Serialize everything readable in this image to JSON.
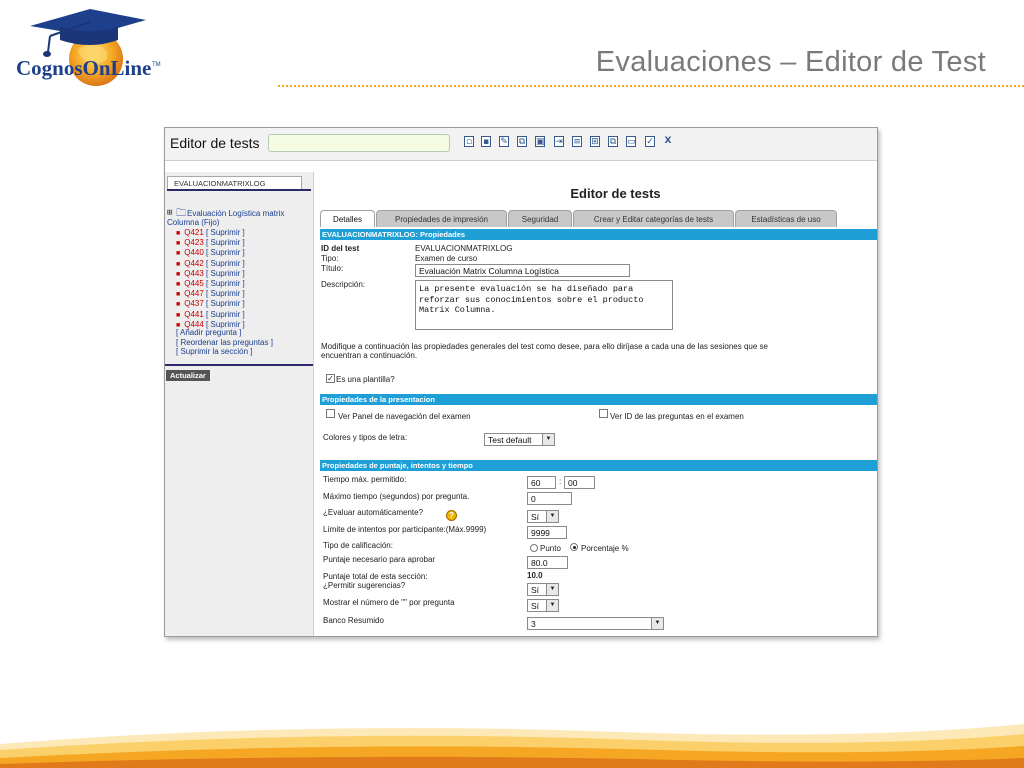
{
  "brand": {
    "logo_text": "CognosOnLine",
    "trademark": "TM"
  },
  "slide": {
    "title": "Evaluaciones – Editor de Test"
  },
  "toolbar": {
    "label": "Editor de tests",
    "input_value": "",
    "icons": [
      "new-doc-icon",
      "save-icon",
      "edit-icon",
      "copy-icon",
      "delete-icon",
      "export-icon",
      "document-icon",
      "tree-icon",
      "duplicate-icon",
      "folder-icon",
      "check-icon",
      "close-x-icon"
    ]
  },
  "sidebar": {
    "tab_label": "EVALUACIONMATRIXLOG",
    "tree_toggle": "⊞",
    "root_label": "Evaluación Logística matrix Columna (Fijo)",
    "items": [
      {
        "id": "Q421",
        "action": "Suprimir"
      },
      {
        "id": "Q423",
        "action": "Suprimir"
      },
      {
        "id": "Q440",
        "action": "Suprimir"
      },
      {
        "id": "Q442",
        "action": "Suprimir"
      },
      {
        "id": "Q443",
        "action": "Suprimir"
      },
      {
        "id": "Q445",
        "action": "Suprimir"
      },
      {
        "id": "Q447",
        "action": "Suprimir"
      },
      {
        "id": "Q437",
        "action": "Suprimir"
      },
      {
        "id": "Q441",
        "action": "Suprimir"
      },
      {
        "id": "Q444",
        "action": "Suprimir"
      }
    ],
    "actions": [
      "[ Añadir pregunta ]",
      "[ Reordenar las preguntas ]",
      "[ Suprimir la sección ]"
    ],
    "update_button": "Actualizar"
  },
  "main": {
    "title": "Editor de tests",
    "tabs": [
      "Detalles",
      "Propiedades de impresión",
      "Seguridad",
      "Crear y Editar categorías de tests",
      "Estadísticas de uso"
    ],
    "active_tab": "Detalles",
    "properties_header": "EVALUACIONMATRIXLOG: Propiedades",
    "fields": {
      "id_label": "ID del test",
      "id_value": "EVALUACIONMATRIXLOG",
      "type_label": "Tipo:",
      "type_value": "Examen de curso",
      "title_label": "Título:",
      "title_value": "Evaluación Matrix Columna Logística",
      "desc_label": "Descripción:",
      "desc_value": "La presente evaluación se ha diseñado para\nreforzar sus conocimientos sobre el producto\nMatrix Columna."
    },
    "info_text_1": "Modifique a continuación las propiedades generales del test como desee, para ello diríjase a cada una de las sesiones que se",
    "info_text_2": "encuentran a continuación.",
    "template_label": "Es una plantilla?",
    "template_checked": true,
    "presentation_header": "Propiedades de la presentacion",
    "nav_panel_label": "Ver Panel de navegación del examen",
    "show_ids_label": "Ver ID de las preguntas en el examen",
    "colors_label": "Colores y tipos de letra:",
    "colors_value": "Test default",
    "scoring_header": "Propiedades de puntaje, intentos y tiempo",
    "scoring": {
      "max_time_label": "Tiempo máx. permitido:",
      "max_time_min": "60",
      "time_sep": ":",
      "max_time_sec": "00",
      "max_q_time_label": "Máximo tiempo (segundos) por pregunta.",
      "max_q_time_value": "0",
      "auto_eval_label": "¿Evaluar automáticamente?",
      "auto_eval_value": "Sí",
      "help_glyph": "?",
      "attempts_label": "Límite de intentos por participante:(Máx.9999)",
      "attempts_value": "9999",
      "grade_type_label": "Tipo de calificación:",
      "grade_opt_point": "Punto",
      "grade_opt_percent": "Porcentaje %",
      "grade_selected": "Porcentaje %",
      "pass_score_label": "Puntaje necesario para aprobar",
      "pass_score_value": "80.0",
      "total_label": "Puntaje total de esta sección:",
      "total_value": "10.0",
      "hints_label": "¿Permitir sugerencias?",
      "hints_value": "Sí",
      "show_number_label": "Mostrar el número de \"\" por pregunta",
      "show_number_value": "Sí",
      "bank_label": "Banco Resumido",
      "bank_value": "3"
    }
  }
}
